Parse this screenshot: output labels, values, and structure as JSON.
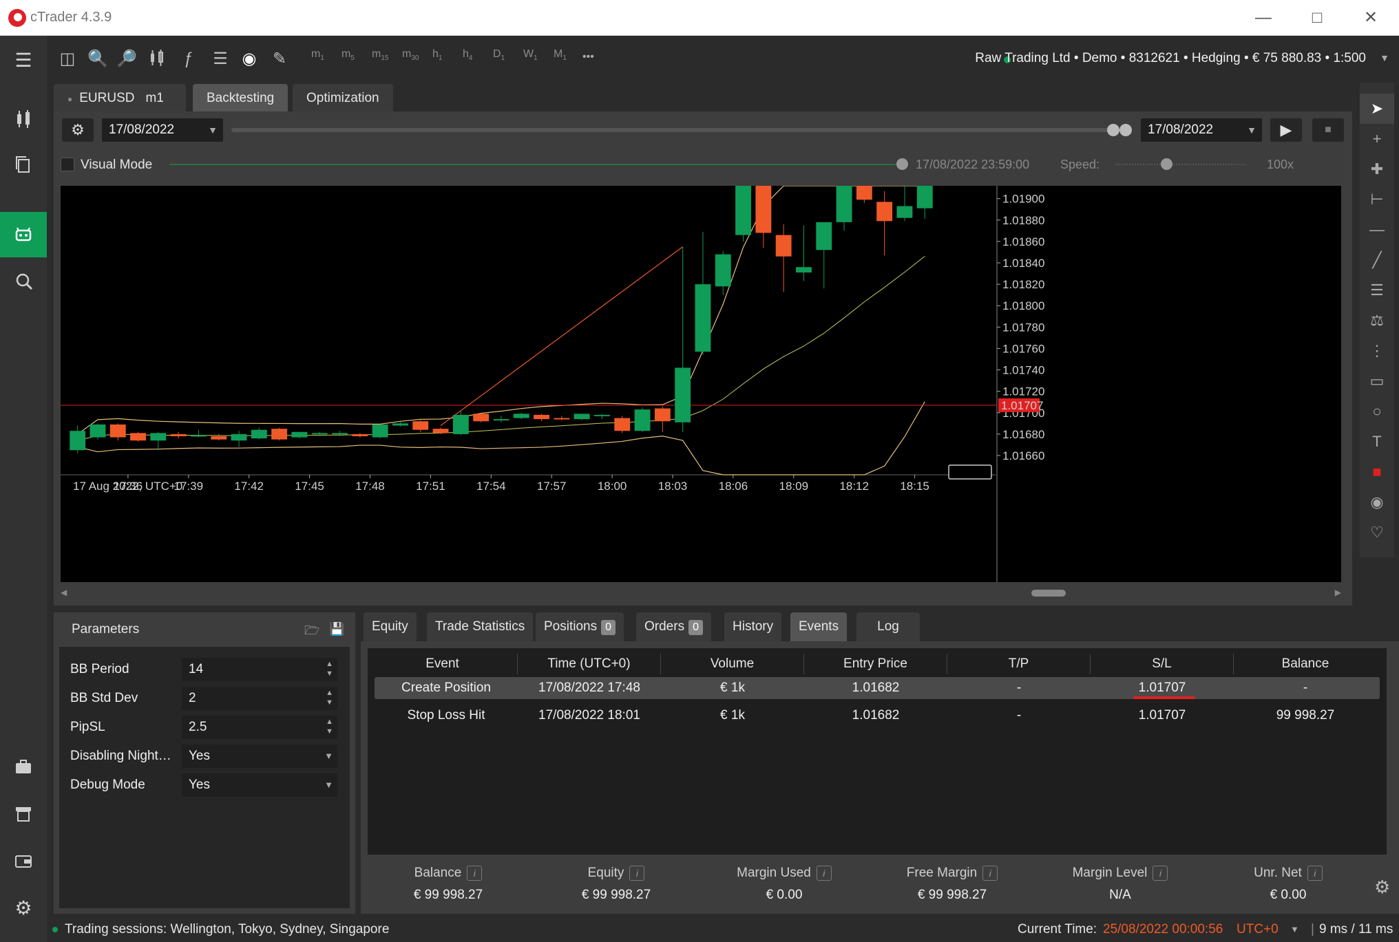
{
  "app": {
    "title": "cTrader 4.3.9"
  },
  "toolbar": {
    "timeframes": [
      {
        "l": "m",
        "s": "1"
      },
      {
        "l": "m",
        "s": "5"
      },
      {
        "l": "m",
        "s": "15"
      },
      {
        "l": "m",
        "s": "30"
      },
      {
        "l": "h",
        "s": "1"
      },
      {
        "l": "h",
        "s": "4"
      },
      {
        "l": "D",
        "s": "1"
      },
      {
        "l": "W",
        "s": "1"
      },
      {
        "l": "M",
        "s": "1"
      }
    ],
    "more": "•••"
  },
  "account": {
    "info": "Raw Trading Ltd • Demo • 8312621 • Hedging • € 75 880.83 • 1:500"
  },
  "tabs": {
    "symbol": "EURUSD",
    "timeframe": "m1",
    "backtesting": "Backtesting",
    "optimization": "Optimization"
  },
  "backtest": {
    "start_date": "17/08/2022",
    "end_date": "17/08/2022",
    "visual_mode": "Visual Mode",
    "visual_time": "17/08/2022 23:59:00",
    "speed_label": "Speed:",
    "speed_value": "100x"
  },
  "chart_data": {
    "type": "candlestick",
    "symbol": "EURUSD",
    "timeframe": "m1",
    "start_label": "17 Aug 2022, UTC+0",
    "x_ticks": [
      "17:36",
      "17:39",
      "17:42",
      "17:45",
      "17:48",
      "17:51",
      "17:54",
      "17:57",
      "18:00",
      "18:03",
      "18:06",
      "18:09",
      "18:12",
      "18:15"
    ],
    "y_ticks": [
      "1.01900",
      "1.01880",
      "1.01860",
      "1.01840",
      "1.01820",
      "1.01800",
      "1.01780",
      "1.01760",
      "1.01740",
      "1.01720",
      "1.01700",
      "1.01680",
      "1.01660"
    ],
    "y_tick_values": [
      1.019,
      1.0188,
      1.0186,
      1.0184,
      1.0182,
      1.018,
      1.0178,
      1.0176,
      1.0174,
      1.0172,
      1.017,
      1.0168,
      1.0166
    ],
    "ylim": [
      1.01642,
      1.01912
    ],
    "price_line": 1.01707,
    "price_label": "1.01707",
    "candles": [
      {
        "o": 1.01665,
        "h": 1.01688,
        "l": 1.01662,
        "c": 1.01683
      },
      {
        "o": 1.01677,
        "h": 1.0169,
        "l": 1.01675,
        "c": 1.01689
      },
      {
        "o": 1.01689,
        "h": 1.0169,
        "l": 1.01674,
        "c": 1.01677
      },
      {
        "o": 1.01681,
        "h": 1.01682,
        "l": 1.01673,
        "c": 1.01674
      },
      {
        "o": 1.01674,
        "h": 1.01682,
        "l": 1.01665,
        "c": 1.01681
      },
      {
        "o": 1.0168,
        "h": 1.01682,
        "l": 1.01676,
        "c": 1.01678
      },
      {
        "o": 1.01679,
        "h": 1.01684,
        "l": 1.01677,
        "c": 1.01679
      },
      {
        "o": 1.01678,
        "h": 1.0168,
        "l": 1.01674,
        "c": 1.01675
      },
      {
        "o": 1.01674,
        "h": 1.01683,
        "l": 1.01668,
        "c": 1.0168
      },
      {
        "o": 1.01676,
        "h": 1.01686,
        "l": 1.01675,
        "c": 1.01684
      },
      {
        "o": 1.01685,
        "h": 1.01686,
        "l": 1.01674,
        "c": 1.01675
      },
      {
        "o": 1.01677,
        "h": 1.01682,
        "l": 1.01676,
        "c": 1.01682
      },
      {
        "o": 1.0168,
        "h": 1.01682,
        "l": 1.01678,
        "c": 1.01681
      },
      {
        "o": 1.01681,
        "h": 1.01683,
        "l": 1.01678,
        "c": 1.01681
      },
      {
        "o": 1.0168,
        "h": 1.01681,
        "l": 1.01677,
        "c": 1.01678
      },
      {
        "o": 1.01677,
        "h": 1.01688,
        "l": 1.01676,
        "c": 1.01689
      },
      {
        "o": 1.01688,
        "h": 1.01693,
        "l": 1.01687,
        "c": 1.0169
      },
      {
        "o": 1.01692,
        "h": 1.01693,
        "l": 1.01682,
        "c": 1.01684
      },
      {
        "o": 1.01685,
        "h": 1.01686,
        "l": 1.0168,
        "c": 1.01681
      },
      {
        "o": 1.0168,
        "h": 1.01702,
        "l": 1.01679,
        "c": 1.01698
      },
      {
        "o": 1.01699,
        "h": 1.017,
        "l": 1.01691,
        "c": 1.01692
      },
      {
        "o": 1.01694,
        "h": 1.01697,
        "l": 1.01691,
        "c": 1.01694
      },
      {
        "o": 1.01695,
        "h": 1.017,
        "l": 1.01694,
        "c": 1.01699
      },
      {
        "o": 1.01698,
        "h": 1.01699,
        "l": 1.01692,
        "c": 1.01694
      },
      {
        "o": 1.01695,
        "h": 1.01697,
        "l": 1.01693,
        "c": 1.01694
      },
      {
        "o": 1.01694,
        "h": 1.01699,
        "l": 1.01693,
        "c": 1.01699
      },
      {
        "o": 1.01697,
        "h": 1.01699,
        "l": 1.01694,
        "c": 1.01698
      },
      {
        "o": 1.01695,
        "h": 1.01697,
        "l": 1.01681,
        "c": 1.01683
      },
      {
        "o": 1.01683,
        "h": 1.01705,
        "l": 1.01682,
        "c": 1.01703
      },
      {
        "o": 1.01704,
        "h": 1.01706,
        "l": 1.01682,
        "c": 1.01692
      },
      {
        "o": 1.01691,
        "h": 1.01855,
        "l": 1.01682,
        "c": 1.01742
      },
      {
        "o": 1.01757,
        "h": 1.01869,
        "l": 1.01754,
        "c": 1.0182
      },
      {
        "o": 1.01818,
        "h": 1.01851,
        "l": 1.0181,
        "c": 1.01848
      },
      {
        "o": 1.01866,
        "h": 1.01908,
        "l": 1.0186,
        "c": 1.01912
      },
      {
        "o": 1.01912,
        "h": 1.01912,
        "l": 1.01854,
        "c": 1.01868
      },
      {
        "o": 1.01866,
        "h": 1.01876,
        "l": 1.01813,
        "c": 1.01846
      },
      {
        "o": 1.01831,
        "h": 1.01875,
        "l": 1.01823,
        "c": 1.01836
      },
      {
        "o": 1.01852,
        "h": 1.01877,
        "l": 1.01816,
        "c": 1.01878
      },
      {
        "o": 1.01878,
        "h": 1.01912,
        "l": 1.0187,
        "c": 1.01912
      },
      {
        "o": 1.01912,
        "h": 1.01912,
        "l": 1.01896,
        "c": 1.01899
      },
      {
        "o": 1.01897,
        "h": 1.01907,
        "l": 1.01847,
        "c": 1.01879
      },
      {
        "o": 1.01882,
        "h": 1.01912,
        "l": 1.01879,
        "c": 1.01893
      },
      {
        "o": 1.01891,
        "h": 1.01912,
        "l": 1.01881,
        "c": 1.01912
      }
    ]
  },
  "params": {
    "title": "Parameters",
    "rows": [
      {
        "label": "BB Period",
        "value": "14"
      },
      {
        "label": "BB Std Dev",
        "value": "2"
      },
      {
        "label": "PipSL",
        "value": "2.5"
      },
      {
        "label": "Disabling Night…",
        "value": "Yes"
      },
      {
        "label": "Debug Mode",
        "value": "Yes"
      }
    ]
  },
  "results": {
    "tabs": {
      "equity": "Equity",
      "trade_stats": "Trade Statistics",
      "positions": "Positions",
      "positions_count": "0",
      "orders": "Orders",
      "orders_count": "0",
      "history": "History",
      "events": "Events",
      "log": "Log"
    },
    "columns": [
      "Event",
      "Time (UTC+0)",
      "Volume",
      "Entry Price",
      "T/P",
      "S/L",
      "Balance"
    ],
    "rows": [
      [
        "Create Position",
        "17/08/2022 17:48",
        "€ 1k",
        "1.01682",
        "-",
        "1.01707",
        "-"
      ],
      [
        "Stop Loss Hit",
        "17/08/2022 18:01",
        "€ 1k",
        "1.01682",
        "-",
        "1.01707",
        "99 998.27"
      ]
    ]
  },
  "summary": [
    {
      "label": "Balance",
      "value": "€ 99 998.27"
    },
    {
      "label": "Equity",
      "value": "€ 99 998.27"
    },
    {
      "label": "Margin Used",
      "value": "€ 0.00"
    },
    {
      "label": "Free Margin",
      "value": "€ 99 998.27"
    },
    {
      "label": "Margin Level",
      "value": "N/A"
    },
    {
      "label": "Unr. Net",
      "value": "€ 0.00"
    }
  ],
  "info_icon": "i",
  "status": {
    "sessions": "Trading sessions: Wellington, Tokyo, Sydney, Singapore",
    "current_label": "Current Time:",
    "current_time": "25/08/2022 00:00:56",
    "tz": "UTC+0",
    "latency": "9 ms / 11 ms"
  },
  "colors": {
    "bull": "#0f9d58",
    "bear": "#f05a28",
    "price_line": "#e02020",
    "bands": "#e8c07a",
    "accent": "#0f9d58"
  }
}
